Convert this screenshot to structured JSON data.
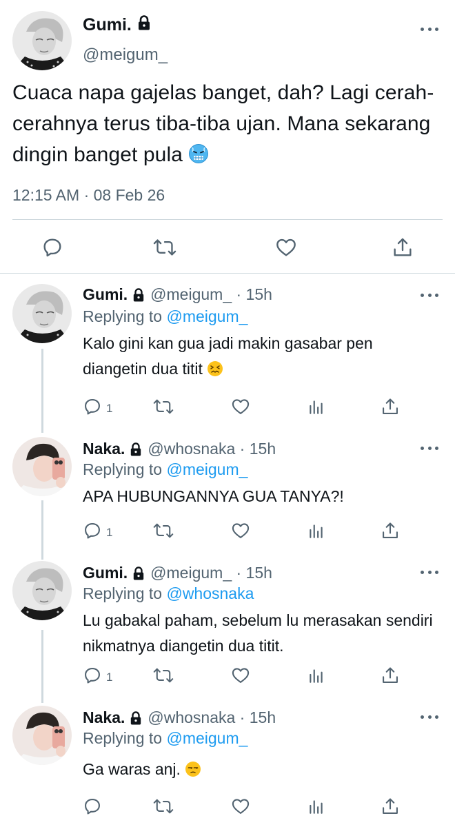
{
  "main_tweet": {
    "name": "Gumi.",
    "handle": "@meigum_",
    "text": "Cuaca napa gajelas banget, dah? Lagi cerah-cerahnya terus tiba-tiba ujan. Mana sekarang dingin banget pula",
    "emoji": "cold-face",
    "timestamp": "12:15 AM · 08 Feb 26",
    "actions": [
      "reply",
      "retweet",
      "like",
      "share"
    ]
  },
  "replies": [
    {
      "name": "Gumi.",
      "handle": "@meigum_ · 15h",
      "replying_prefix": "Replying to",
      "replying_to": "@meigum_",
      "text": "Kalo gini kan gua jadi makin gasabar pen diangetin dua titit",
      "emoji": "confounded-face",
      "reply_count": "1",
      "avatar": "gumi"
    },
    {
      "name": "Naka.",
      "handle": "@whosnaka · 15h",
      "replying_prefix": "Replying to",
      "replying_to": "@meigum_",
      "text": "APA HUBUNGANNYA GUA TANYA?!",
      "emoji": "",
      "reply_count": "1",
      "avatar": "naka"
    },
    {
      "name": "Gumi.",
      "handle": "@meigum_ · 15h",
      "replying_prefix": "Replying to",
      "replying_to": "@whosnaka",
      "text": "Lu gabakal paham, sebelum lu merasakan sendiri nikmatnya diangetin dua titit.",
      "emoji": "",
      "reply_count": "1",
      "avatar": "gumi"
    },
    {
      "name": "Naka.",
      "handle": "@whosnaka · 15h",
      "replying_prefix": "Replying to",
      "replying_to": "@meigum_",
      "text": "Ga waras anj.",
      "emoji": "unamused-face",
      "reply_count": "",
      "avatar": "naka"
    }
  ],
  "colors": {
    "text": "#0f1419",
    "secondary": "#536471",
    "link": "#1d9bf0",
    "divider": "#cfd9de"
  }
}
